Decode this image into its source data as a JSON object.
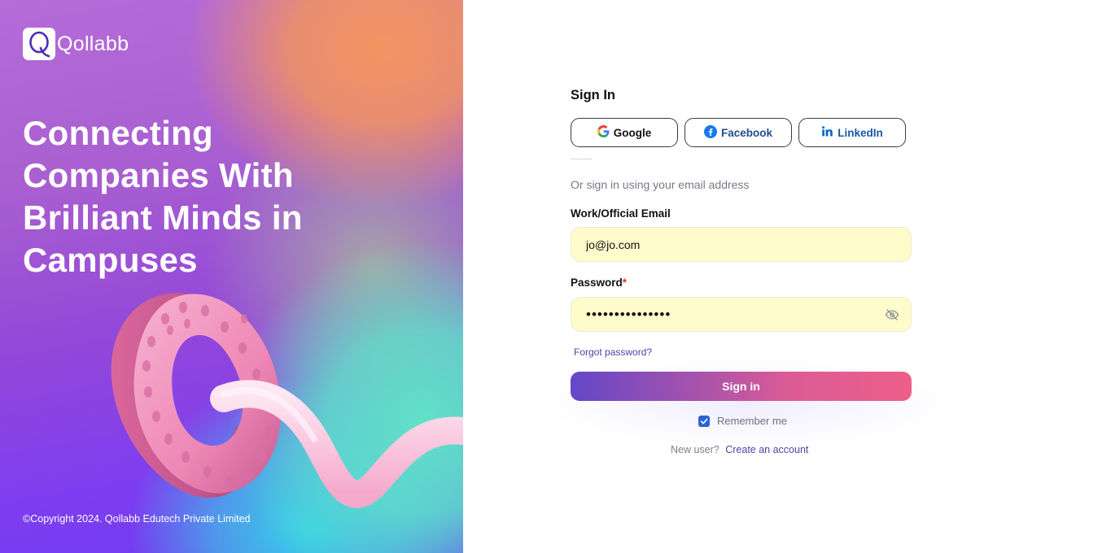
{
  "brand": {
    "name": "Qollabb"
  },
  "hero": {
    "headline": "Connecting Companies With Brilliant Minds in Campuses",
    "copyright": "©Copyright 2024. Qollabb Edutech Private Limited"
  },
  "form": {
    "title": "Sign In",
    "social": {
      "google": "Google",
      "facebook": "Facebook",
      "linkedin": "LinkedIn"
    },
    "or_text": "Or sign in using your email address",
    "email": {
      "label": "Work/Official Email",
      "value": "jo@jo.com"
    },
    "password": {
      "label": "Password",
      "required_mark": "*",
      "value": "•••••••••••••••"
    },
    "forgot": "Forgot password?",
    "submit": "Sign in",
    "remember": {
      "label": "Remember me",
      "checked": true
    },
    "new_user": {
      "prompt": "New user?",
      "link": "Create an account"
    }
  },
  "icons": {
    "logo": "q-logo-icon",
    "google": "google-icon",
    "facebook": "facebook-icon",
    "linkedin": "linkedin-icon",
    "visibility": "eye-off-icon",
    "check": "check-icon"
  },
  "colors": {
    "accent": "#4a45a8",
    "field_bg": "#fffbcb",
    "button_start": "#6447c8",
    "button_end": "#ed5f8a",
    "facebook": "#1877f2",
    "linkedin": "#0a66c2"
  }
}
